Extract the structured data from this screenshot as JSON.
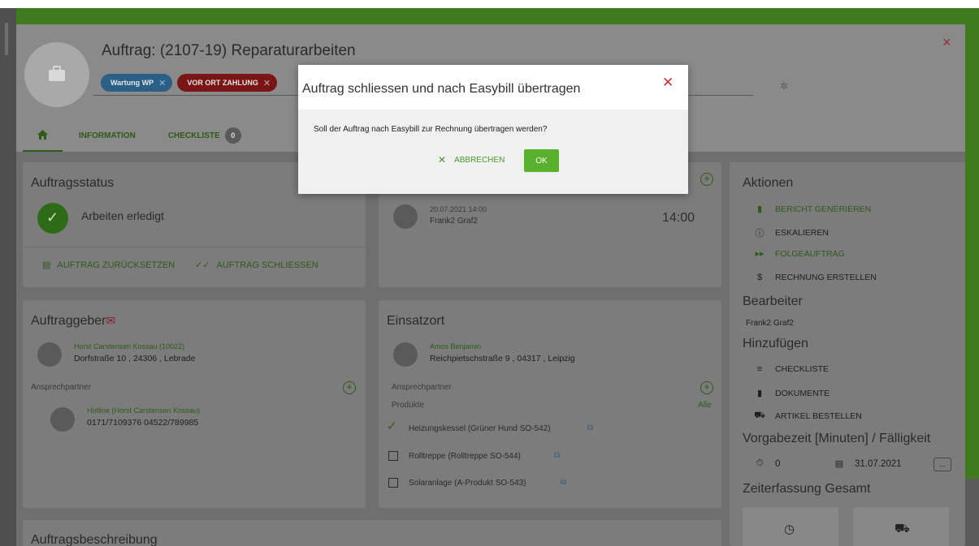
{
  "order": {
    "title": "Auftrag: (2107-19) Reparaturarbeiten",
    "tags": [
      {
        "label": "Wartung WP",
        "color": "#2a5f86"
      },
      {
        "label": "VOR ORT ZAHLUNG",
        "color": "#7a1515"
      }
    ],
    "close_icon": "×",
    "tabs": {
      "home_icon": "home-icon",
      "information": "INFORMATION",
      "checkliste": "CHECKLISTE",
      "checkliste_count": "0"
    }
  },
  "status": {
    "title": "Auftragsstatus",
    "state": "Arbeiten erledigt",
    "reset": "AUFTRAG ZURÜCKSETZEN",
    "close": "AUFTRAG SCHLIESSEN"
  },
  "appointment": {
    "date": "20.07.2021 14:00",
    "person": "Frank2 Graf2",
    "time": "14:00"
  },
  "client": {
    "title": "Auftraggeber",
    "name": "Horst Carstensen Kossau (10022)",
    "address": "Dorfstraße 10 , 24306 , Lebrade",
    "contact_label": "Ansprechpartner",
    "contact_name": "Hotline (Horst Carstensen Kossau)",
    "contact_phone": "0171/7109376 04522/789985"
  },
  "site": {
    "title": "Einsatzort",
    "name": "Amos Benjamin",
    "address": "Reichpietschstraße 9 , 04317 , Leipzig",
    "contact_label": "Ansprechpartner",
    "products_label": "Produkte",
    "all_link": "Alle",
    "products": [
      {
        "name": "Heizungskessel (Grüner Hund SO-542)",
        "checked": true
      },
      {
        "name": "Rolltreppe (Rolltreppe SO-544)",
        "checked": false
      },
      {
        "name": "Solaranlage (A-Produkt SO-543)",
        "checked": false
      }
    ]
  },
  "description": {
    "title": "Auftragsbeschreibung"
  },
  "sidebar": {
    "actions_title": "Aktionen",
    "actions": [
      {
        "label": "BERICHT GENERIEREN",
        "icon": "file-icon"
      },
      {
        "label": "ESKALIEREN",
        "icon": "alert-icon"
      },
      {
        "label": "FOLGEAUFTRAG",
        "icon": "forward-icon"
      },
      {
        "label": "RECHNUNG ERSTELLEN",
        "icon": "dollar-icon"
      }
    ],
    "editor_title": "Bearbeiter",
    "editor_name": "Frank2 Graf2",
    "add_title": "Hinzufügen",
    "add_items": [
      {
        "label": "CHECKLISTE",
        "icon": "checklist-icon"
      },
      {
        "label": "DOKUMENTE",
        "icon": "document-icon"
      },
      {
        "label": "ARTIKEL BESTELLEN",
        "icon": "truck-icon"
      }
    ],
    "preset_title": "Vorgabezeit [Minuten] / Fälligkeit",
    "preset_minutes": "0",
    "due_date": "31.07.2021",
    "more_button": "...",
    "time_title": "Zeiterfassung Gesamt"
  },
  "dialog": {
    "title": "Auftrag schliessen und nach Easybill übertragen",
    "message": "Soll der Auftrag nach Easybill zur Rechnung übertragen werden?",
    "cancel": "ABBRECHEN",
    "ok": "OK",
    "close_icon": "✕"
  }
}
